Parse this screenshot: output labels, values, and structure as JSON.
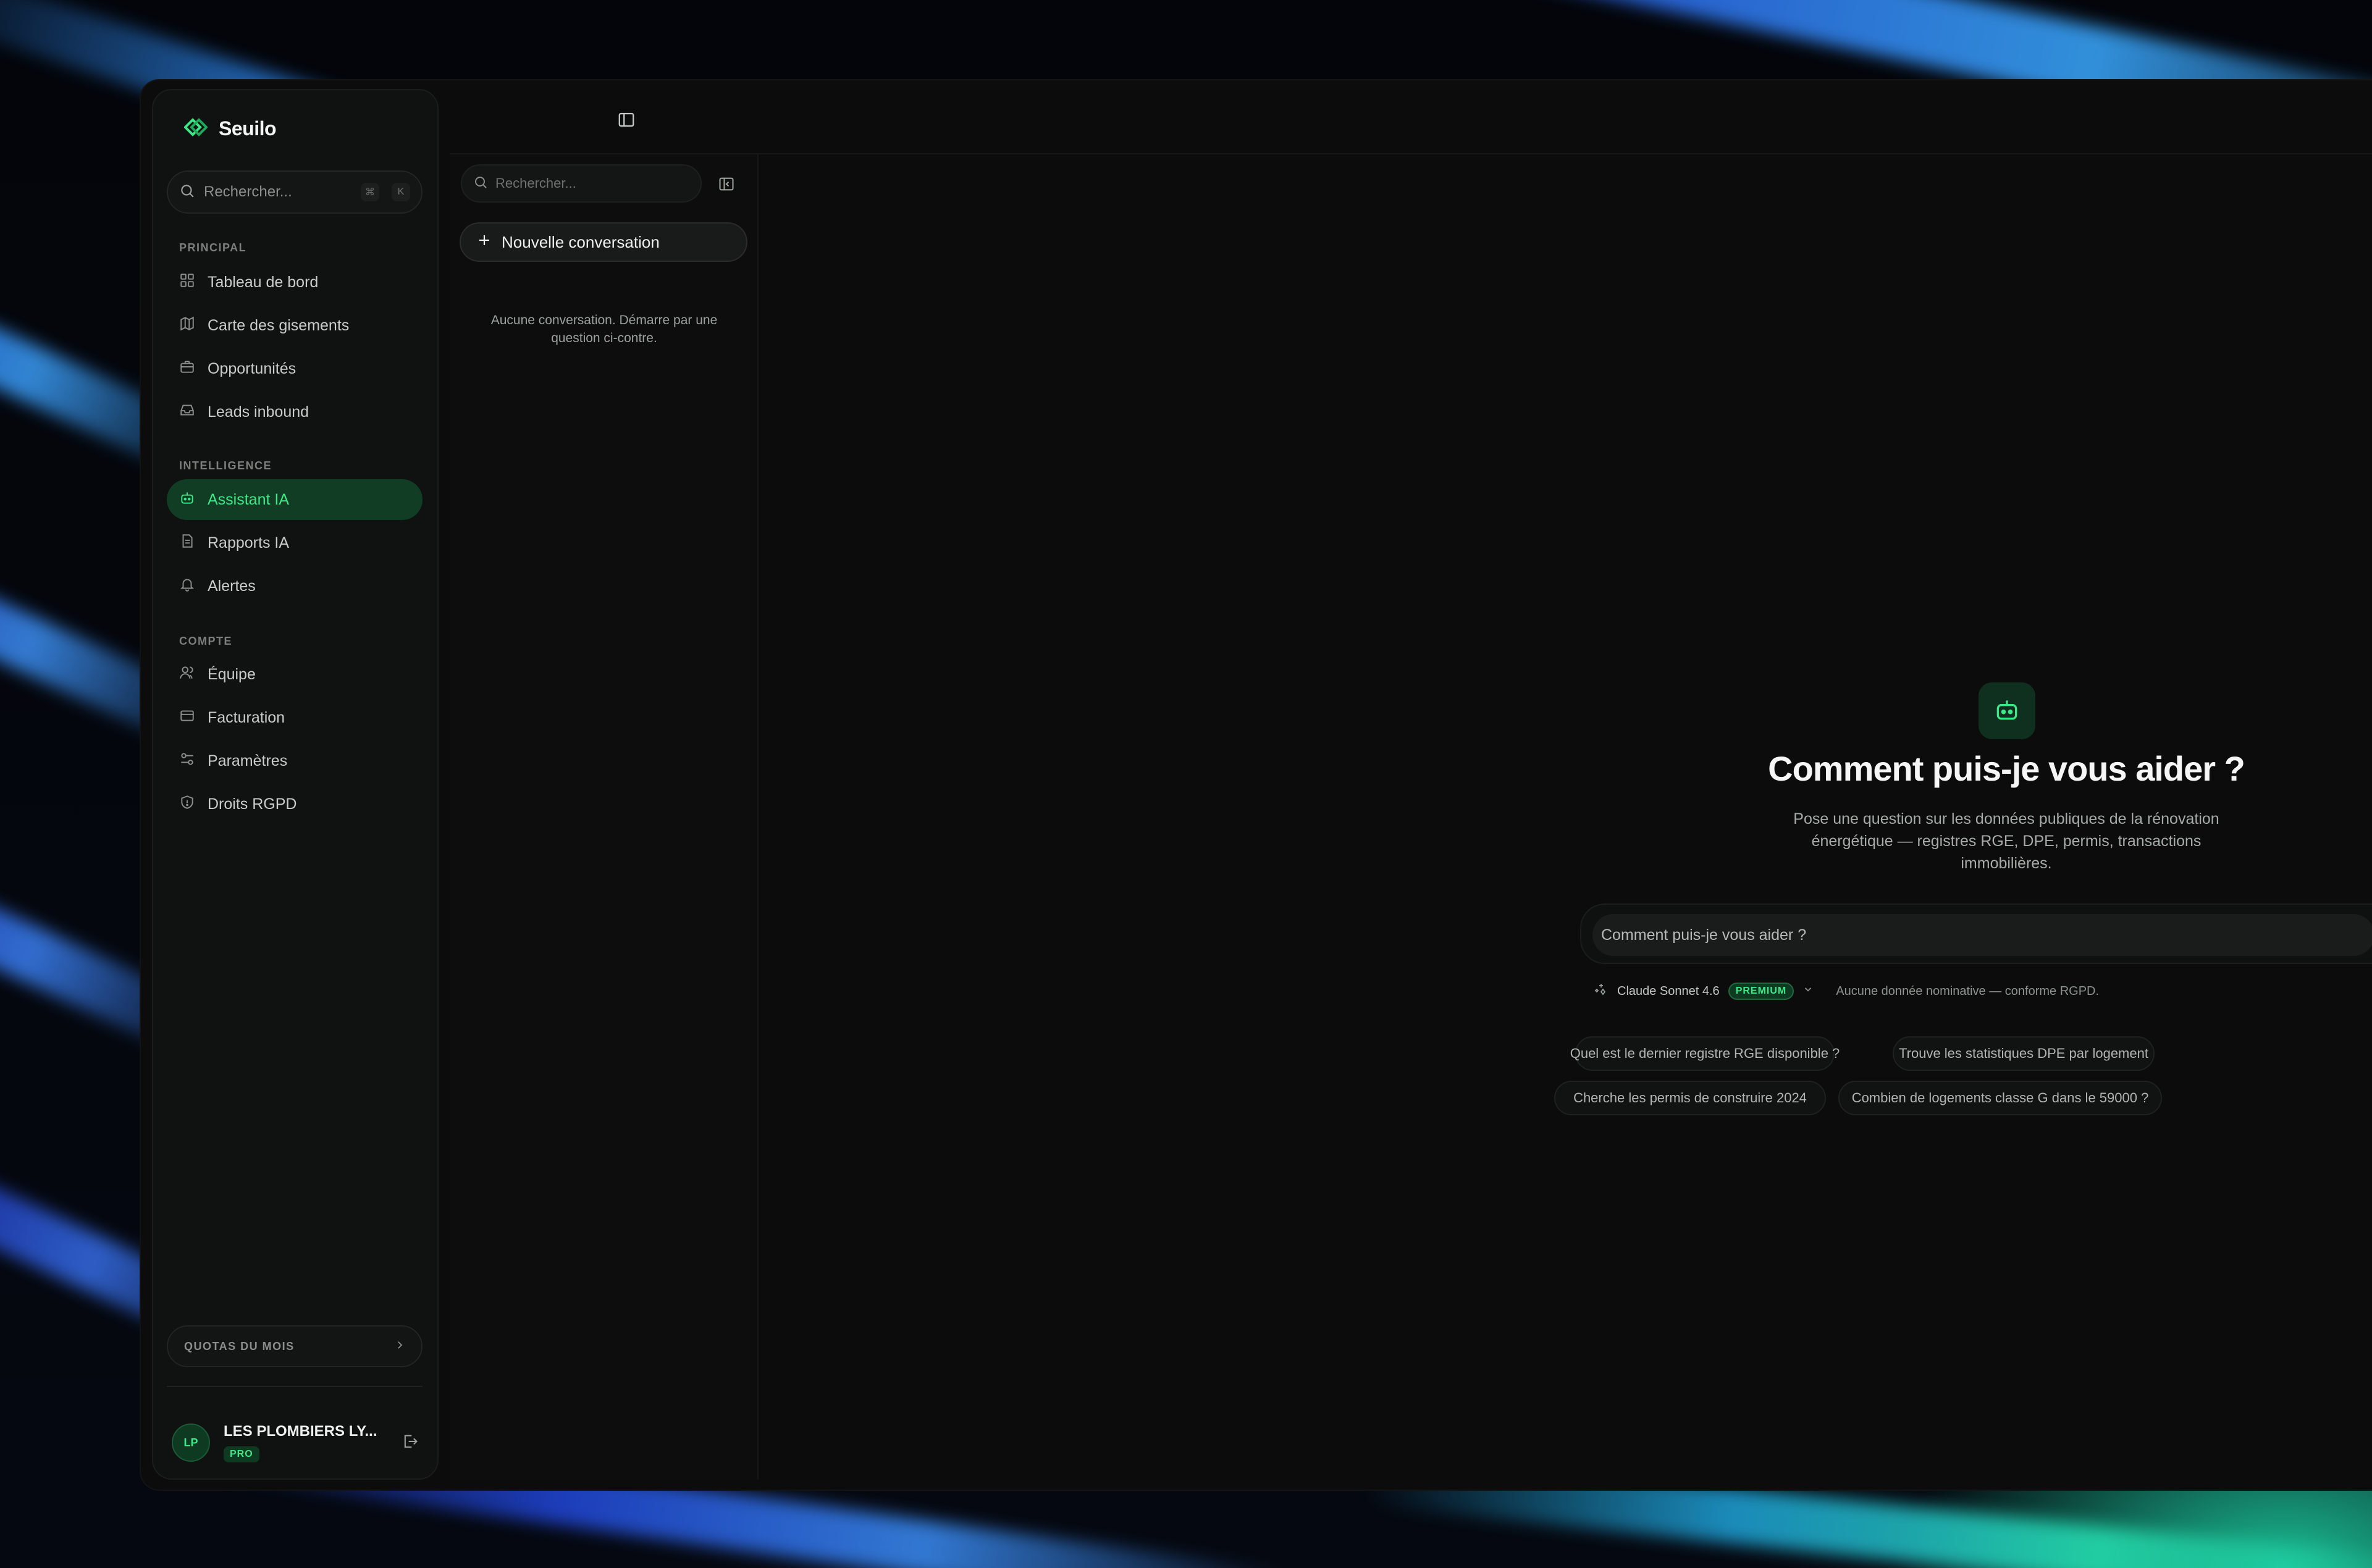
{
  "app": {
    "name": "Seuilo",
    "accent": "#3ee887",
    "brand_color": "#1fa95c"
  },
  "sidebar": {
    "search_placeholder": "Rechercher...",
    "shortcut": [
      "⌘",
      "K"
    ],
    "sections": [
      {
        "label": "PRINCIPAL",
        "items": [
          {
            "label": "Tableau de bord",
            "icon": "dashboard-icon"
          },
          {
            "label": "Carte des gisements",
            "icon": "map-icon"
          },
          {
            "label": "Opportunités",
            "icon": "briefcase-icon"
          },
          {
            "label": "Leads inbound",
            "icon": "inbox-icon"
          }
        ]
      },
      {
        "label": "INTELLIGENCE",
        "items": [
          {
            "label": "Assistant IA",
            "icon": "bot-icon",
            "active": true
          },
          {
            "label": "Rapports IA",
            "icon": "report-icon"
          },
          {
            "label": "Alertes",
            "icon": "bell-icon"
          }
        ]
      },
      {
        "label": "COMPTE",
        "items": [
          {
            "label": "Équipe",
            "icon": "users-icon"
          },
          {
            "label": "Facturation",
            "icon": "credit-card-icon"
          },
          {
            "label": "Paramètres",
            "icon": "sliders-icon"
          },
          {
            "label": "Droits RGPD",
            "icon": "shield-icon"
          }
        ]
      }
    ],
    "quota_label": "QUOTAS DU MOIS",
    "user": {
      "initials": "LP",
      "name": "LES PLOMBIERS LY...",
      "plan": "PRO"
    }
  },
  "conversations": {
    "search_placeholder": "Rechercher...",
    "new_label": "Nouvelle conversation",
    "empty_text": "Aucune conversation. Démarre par une question ci-contre."
  },
  "chat": {
    "headline": "Comment puis-je vous aider ?",
    "subtext": "Pose une question sur les données publiques de la rénovation énergétique — registres RGE, DPE, permis, transactions immobilières.",
    "input_placeholder": "Comment puis-je vous aider ?",
    "model_name": "Claude Sonnet 4.6",
    "model_badge": "PREMIUM",
    "rgpd_note": "Aucune donnée nominative — conforme RGPD.",
    "suggestions": [
      "Quel est le dernier registre RGE disponible ?",
      "Trouve les statistiques DPE par logement",
      "Cherche les permis de construire 2024",
      "Combien de logements classe G dans le 59000 ?"
    ]
  }
}
